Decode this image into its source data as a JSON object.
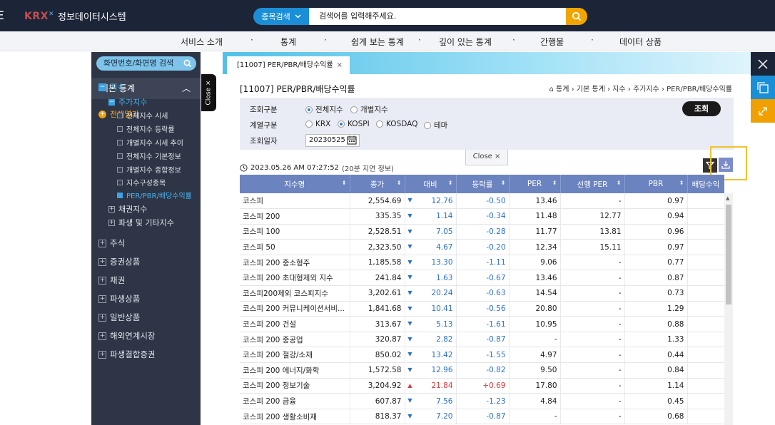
{
  "header": {
    "menu_glyph": "Ξ",
    "logo_mark": "KRX",
    "logo_text": "정보데이터시스템",
    "search_category": "종목검색",
    "search_placeholder": "검색어를 입력해주세요."
  },
  "menu": [
    "서비스 소개",
    "통계",
    "쉽게 보는 통계",
    "깊이 있는 통계",
    "간행물",
    "데이터 상품"
  ],
  "sidebar": {
    "search_label": "화면번호/화면명 검색",
    "section": "기본 통계",
    "expand_all": "전체열기",
    "tree": [
      {
        "label": "지수",
        "level": 1,
        "icon": "minus",
        "active": true
      },
      {
        "label": "주가지수",
        "level": 2,
        "icon": "minus",
        "active": true
      },
      {
        "label": "전체지수 시세",
        "level": 3
      },
      {
        "label": "전체지수 등락률",
        "level": 3
      },
      {
        "label": "개별지수 시세 추이",
        "level": 3
      },
      {
        "label": "전체지수 기본정보",
        "level": 3
      },
      {
        "label": "개별지수 종합정보",
        "level": 3
      },
      {
        "label": "지수구성종목",
        "level": 3
      },
      {
        "label": "PER/PBR/배당수익률",
        "level": 3,
        "active": true
      },
      {
        "label": "채권지수",
        "level": 2,
        "icon": "plus"
      },
      {
        "label": "파생 및 기타지수",
        "level": 2,
        "icon": "plus"
      },
      {
        "label": "주식",
        "level": 1,
        "icon": "plus"
      },
      {
        "label": "증권상품",
        "level": 1,
        "icon": "plus"
      },
      {
        "label": "채권",
        "level": 1,
        "icon": "plus"
      },
      {
        "label": "파생상품",
        "level": 1,
        "icon": "plus"
      },
      {
        "label": "일반상품",
        "level": 1,
        "icon": "plus"
      },
      {
        "label": "해외연계시장",
        "level": 1,
        "icon": "plus"
      },
      {
        "label": "파생결합증권",
        "level": 1,
        "icon": "plus"
      }
    ]
  },
  "close_tab": "Close ×",
  "tab": {
    "label": "[11007] PER/PBR/배당수익률",
    "close": "×"
  },
  "page": {
    "title": "[11007] PER/PBR/배당수익률",
    "breadcrumb": [
      "통계",
      "기본 통계",
      "지수",
      "주가지수",
      "PER/PBR/배당수익률"
    ]
  },
  "filter": {
    "row1_label": "조회구분",
    "row1_options": [
      {
        "label": "전체지수",
        "checked": true
      },
      {
        "label": "개별지수",
        "checked": false
      }
    ],
    "row2_label": "계열구분",
    "row2_options": [
      {
        "label": "KRX",
        "checked": false
      },
      {
        "label": "KOSPI",
        "checked": true
      },
      {
        "label": "KOSDAQ",
        "checked": false
      },
      {
        "label": "테마",
        "checked": false
      }
    ],
    "date_label": "조회일자",
    "date_value": "20230525",
    "search_button": "조회"
  },
  "close_bar": "Close ×",
  "timestamp": "2023.05.26 AM 07:27:52",
  "timestamp_note": "(20분 지연 정보)",
  "table": {
    "headers": [
      "지수명",
      "종가",
      "대비",
      "등락률",
      "PER",
      "선행 PER",
      "PBR",
      "배당수익"
    ],
    "rows": [
      [
        "코스피",
        "2,554.69",
        "down",
        "12.76",
        "-0.50",
        "13.46",
        "-",
        "0.97"
      ],
      [
        "코스피 200",
        "335.35",
        "down",
        "1.14",
        "-0.34",
        "11.48",
        "12.77",
        "0.94"
      ],
      [
        "코스피 100",
        "2,528.51",
        "down",
        "7.05",
        "-0.28",
        "11.77",
        "13.81",
        "0.96"
      ],
      [
        "코스피 50",
        "2,323.50",
        "down",
        "4.67",
        "-0.20",
        "12.34",
        "15.11",
        "0.97"
      ],
      [
        "코스피 200 중소형주",
        "1,185.58",
        "down",
        "13.30",
        "-1.11",
        "9.06",
        "-",
        "0.77"
      ],
      [
        "코스피 200 초대형제외 지수",
        "241.84",
        "down",
        "1.63",
        "-0.67",
        "13.46",
        "-",
        "0.87"
      ],
      [
        "코스피200제외 코스피지수",
        "3,202.61",
        "down",
        "20.24",
        "-0.63",
        "14.54",
        "-",
        "0.73"
      ],
      [
        "코스피 200 커뮤니케이션서비...",
        "1,841.68",
        "down",
        "10.41",
        "-0.56",
        "20.80",
        "-",
        "1.29"
      ],
      [
        "코스피 200 건설",
        "313.67",
        "down",
        "5.13",
        "-1.61",
        "10.95",
        "-",
        "0.88"
      ],
      [
        "코스피 200 중공업",
        "320.87",
        "down",
        "2.82",
        "-0.87",
        "-",
        "-",
        "1.33"
      ],
      [
        "코스피 200 철강/소재",
        "850.02",
        "down",
        "13.42",
        "-1.55",
        "4.97",
        "-",
        "0.44"
      ],
      [
        "코스피 200 에너지/화학",
        "1,572.58",
        "down",
        "12.96",
        "-0.82",
        "9.50",
        "-",
        "0.84"
      ],
      [
        "코스피 200 정보기술",
        "3,204.92",
        "up",
        "21.84",
        "+0.69",
        "17.80",
        "-",
        "1.14"
      ],
      [
        "코스피 200 금융",
        "607.87",
        "down",
        "7.56",
        "-1.23",
        "4.84",
        "-",
        "0.45"
      ],
      [
        "코스피 200 생활소비재",
        "818.37",
        "down",
        "7.20",
        "-0.87",
        "-",
        "-",
        "0.68"
      ]
    ]
  },
  "colors": {
    "topbar": "#1c2538",
    "sidebar": "#2d3546",
    "table_header": "#6b83bf",
    "accent_blue": "#1a8fd8",
    "accent_orange": "#f0a500",
    "highlight": "#f2c12e"
  }
}
